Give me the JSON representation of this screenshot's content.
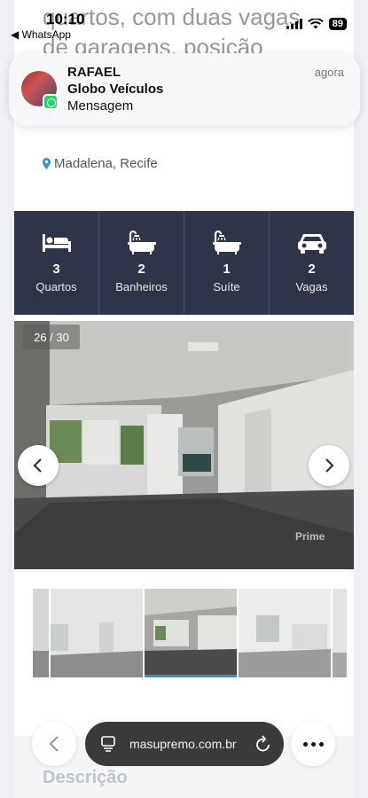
{
  "status_bar": {
    "time": "10:10",
    "back_app": "◀ WhatsApp",
    "battery": "89"
  },
  "listing": {
    "headline": "quartos, com duas vagas de garagens, posição",
    "location": "Madalena, Recife"
  },
  "notification": {
    "sender": "RAFAEL",
    "group": "Globo Veículos",
    "message": "Mensagem",
    "time": "agora",
    "app_icon": "whatsapp-icon"
  },
  "features": [
    {
      "icon": "bed-icon",
      "count": "3",
      "label": "Quartos"
    },
    {
      "icon": "bathtub-icon",
      "count": "2",
      "label": "Banheiros"
    },
    {
      "icon": "suite-icon",
      "count": "1",
      "label": "Suíte"
    },
    {
      "icon": "car-icon",
      "count": "2",
      "label": "Vagas"
    }
  ],
  "gallery": {
    "counter": "26 / 30",
    "watermark": "Prime"
  },
  "description": {
    "title": "Descrição"
  },
  "browser": {
    "url": "masupremo.com.br"
  },
  "colors": {
    "features_bg": "#2f3548",
    "thumb_active": "#3b8fd9",
    "url_bar_bg": "#3a3a3c"
  }
}
